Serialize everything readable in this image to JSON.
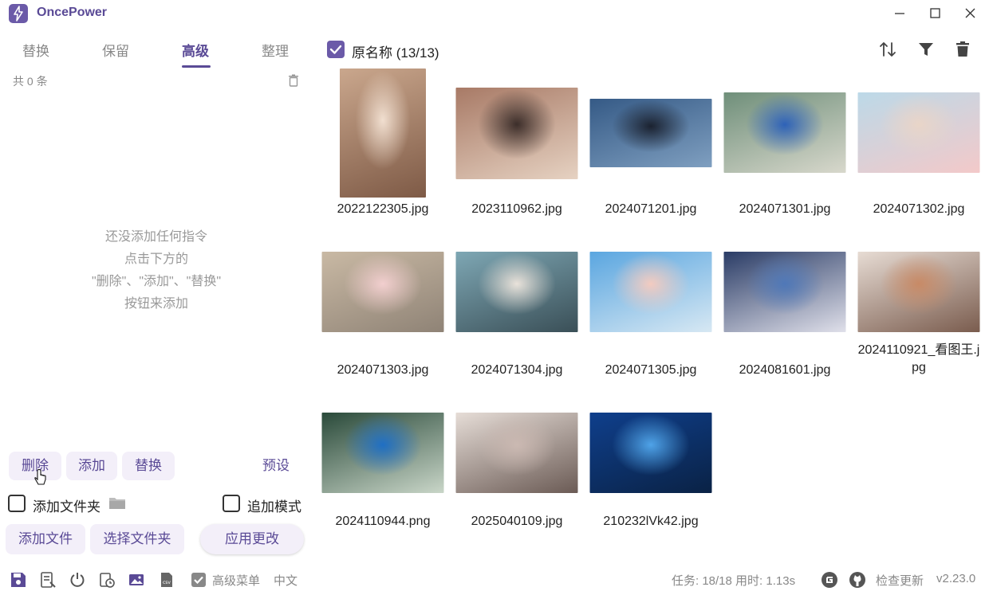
{
  "app": {
    "title": "OncePower"
  },
  "tabs": [
    "替换",
    "保留",
    "高级",
    "整理"
  ],
  "active_tab": "高级",
  "rules": {
    "count_label": "共 0 条",
    "empty_lines": [
      "还没添加任何指令",
      "点击下方的",
      "\"删除\"、\"添加\"、\"替换\"",
      "按钮来添加"
    ]
  },
  "actions": {
    "delete": "删除",
    "add": "添加",
    "replace": "替换",
    "preset": "预设"
  },
  "options": {
    "add_folder": "添加文件夹",
    "append_mode": "追加模式"
  },
  "file_buttons": {
    "add_files": "添加文件",
    "select_folder": "选择文件夹",
    "apply": "应用更改"
  },
  "header": {
    "select_label": "原名称 (13/13)"
  },
  "files": [
    {
      "name": "2022122305.jpg",
      "colors": [
        "#caa78d",
        "#f1dfd0",
        "#7e5a46"
      ],
      "orientation": "portrait"
    },
    {
      "name": "2023110962.jpg",
      "colors": [
        "#a87a66",
        "#3c2e2a",
        "#e6d2c2"
      ],
      "orientation": "landscape"
    },
    {
      "name": "2024071201.jpg",
      "colors": [
        "#355a86",
        "#1b2230",
        "#7f9fc0"
      ],
      "orientation": "landscape"
    },
    {
      "name": "2024071301.jpg",
      "colors": [
        "#6f8f7a",
        "#2e62b8",
        "#d8d8cc"
      ],
      "orientation": "landscape"
    },
    {
      "name": "2024071302.jpg",
      "colors": [
        "#bcd9e8",
        "#e9d5c8",
        "#f3c9c9"
      ],
      "orientation": "landscape"
    },
    {
      "name": "2024071303.jpg",
      "colors": [
        "#c9b9a4",
        "#f2cfcf",
        "#8f8376"
      ],
      "orientation": "landscape"
    },
    {
      "name": "2024071304.jpg",
      "colors": [
        "#7ea7b4",
        "#e9e2da",
        "#3a4f57"
      ],
      "orientation": "landscape"
    },
    {
      "name": "2024071305.jpg",
      "colors": [
        "#5aa6e0",
        "#f3cbc0",
        "#d7e8f3"
      ],
      "orientation": "landscape"
    },
    {
      "name": "2024081601.jpg",
      "colors": [
        "#2a3c66",
        "#4f78b8",
        "#e0e0ea"
      ],
      "orientation": "landscape"
    },
    {
      "name": "2024110921_看图王.jpg",
      "colors": [
        "#e7dcd4",
        "#c88a66",
        "#7a5c4e"
      ],
      "orientation": "landscape"
    },
    {
      "name": "2024110944.png",
      "colors": [
        "#2a4a3a",
        "#1f6fc4",
        "#c9d6c8"
      ],
      "orientation": "landscape"
    },
    {
      "name": "2025040109.jpg",
      "colors": [
        "#e6ddd7",
        "#cbb9b2",
        "#6b5b55"
      ],
      "orientation": "landscape"
    },
    {
      "name": "210232lVk42.jpg",
      "colors": [
        "#0f3f8c",
        "#4fa3e8",
        "#0a2245"
      ],
      "orientation": "landscape"
    }
  ],
  "status": {
    "menu_label": "高级菜单",
    "language": "中文",
    "tasks": "任务: 18/18 用时: 1.13s",
    "check_update": "检查更新",
    "version": "v2.23.0"
  },
  "colors": {
    "accent": "#6b5aa8",
    "accent_text": "#5a4a96",
    "pill_bg": "#f3eff9"
  },
  "status_icons": [
    "save-icon",
    "notes-icon",
    "power-icon",
    "schedule-icon",
    "image-icon",
    "csv-icon",
    "check-box-icon"
  ]
}
